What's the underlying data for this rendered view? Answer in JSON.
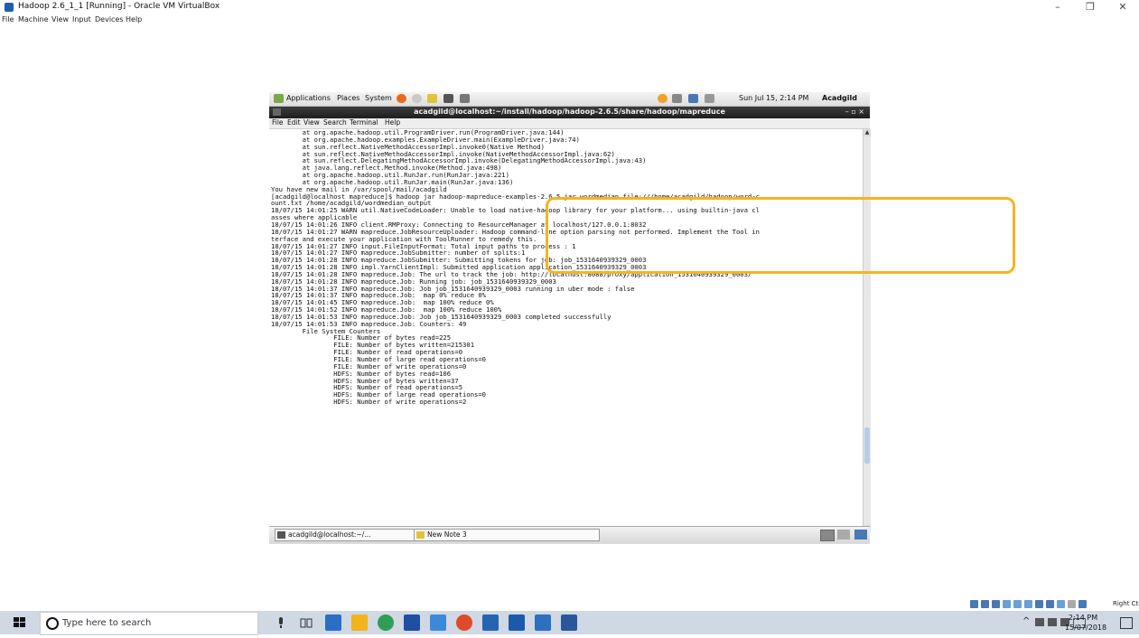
{
  "host_window": {
    "title": "Hadoop 2.6_1_1 [Running] - Oracle VM VirtualBox",
    "controls": {
      "minimize": "–",
      "restore": "❐",
      "close": "✕"
    },
    "menu": [
      "File",
      "Machine",
      "View",
      "Input",
      "Devices",
      "Help"
    ]
  },
  "guest_panel": {
    "menus": [
      "Applications",
      "Places",
      "System"
    ],
    "datetime": "Sun Jul 15,  2:14 PM",
    "user": "Acadgild"
  },
  "terminal": {
    "title": "acadgild@localhost:~/install/hadoop/hadoop-2.6.5/share/hadoop/mapreduce",
    "window_controls": "–  ▫  ×",
    "menu": [
      "File",
      "Edit",
      "View",
      "Search",
      "Terminal",
      "Help"
    ],
    "lines": [
      "        at org.apache.hadoop.util.ProgramDriver.run(ProgramDriver.java:144)",
      "        at org.apache.hadoop.examples.ExampleDriver.main(ExampleDriver.java:74)",
      "        at sun.reflect.NativeMethodAccessorImpl.invoke0(Native Method)",
      "        at sun.reflect.NativeMethodAccessorImpl.invoke(NativeMethodAccessorImpl.java:62)",
      "        at sun.reflect.DelegatingMethodAccessorImpl.invoke(DelegatingMethodAccessorImpl.java:43)",
      "        at java.lang.reflect.Method.invoke(Method.java:498)",
      "        at org.apache.hadoop.util.RunJar.run(RunJar.java:221)",
      "        at org.apache.hadoop.util.RunJar.main(RunJar.java:136)",
      "You have new mail in /var/spool/mail/acadgild",
      "[acadgild@localhost mapreduce]$ hadoop jar hadoop-mapreduce-examples-2.6.5.jar wordmedian file:///home/acadgild/hadoop/word-c",
      "ount.txt /home/acadgild/wordmedian_output",
      "18/07/15 14:01:25 WARN util.NativeCodeLoader: Unable to load native-hadoop library for your platform... using builtin-java cl",
      "asses where applicable",
      "18/07/15 14:01:26 INFO client.RMProxy: Connecting to ResourceManager at localhost/127.0.0.1:8032",
      "18/07/15 14:01:27 WARN mapreduce.JobResourceUploader: Hadoop command-line option parsing not performed. Implement the Tool in",
      "terface and execute your application with ToolRunner to remedy this.",
      "18/07/15 14:01:27 INFO input.FileInputFormat: Total input paths to process : 1",
      "18/07/15 14:01:27 INFO mapreduce.JobSubmitter: number of splits:1",
      "18/07/15 14:01:28 INFO mapreduce.JobSubmitter: Submitting tokens for job: job_1531640939329_0003",
      "18/07/15 14:01:28 INFO impl.YarnClientImpl: Submitted application application_1531640939329_0003",
      "18/07/15 14:01:28 INFO mapreduce.Job: The url to track the job: http://localhost:8088/proxy/application_1531640939329_0003/",
      "18/07/15 14:01:28 INFO mapreduce.Job: Running job: job_1531640939329_0003",
      "18/07/15 14:01:37 INFO mapreduce.Job: Job job_1531640939329_0003 running in uber mode : false",
      "18/07/15 14:01:37 INFO mapreduce.Job:  map 0% reduce 0%",
      "18/07/15 14:01:45 INFO mapreduce.Job:  map 100% reduce 0%",
      "18/07/15 14:01:52 INFO mapreduce.Job:  map 100% reduce 100%",
      "18/07/15 14:01:53 INFO mapreduce.Job: Job job_1531640939329_0003 completed successfully",
      "18/07/15 14:01:53 INFO mapreduce.Job: Counters: 49",
      "        File System Counters",
      "                FILE: Number of bytes read=225",
      "                FILE: Number of bytes written=215301",
      "                FILE: Number of read operations=0",
      "                FILE: Number of large read operations=0",
      "                FILE: Number of write operations=0",
      "                HDFS: Number of bytes read=106",
      "                HDFS: Number of bytes written=37",
      "                HDFS: Number of read operations=5",
      "                HDFS: Number of large read operations=0",
      "                HDFS: Number of write operations=2"
    ]
  },
  "guest_taskbar": {
    "items": [
      "acadgild@localhost:~/...",
      "New Note 3"
    ]
  },
  "vb_status": {
    "host_key": "Right Ctrl"
  },
  "win_taskbar": {
    "search_placeholder": "Type here to search",
    "clock_time": "2:14 PM",
    "clock_date": "15/07/2018"
  },
  "colors": {
    "highlight": "#f5b324",
    "taskbar": "#cfd8e3",
    "terminal_title": "#2a2a2a"
  }
}
